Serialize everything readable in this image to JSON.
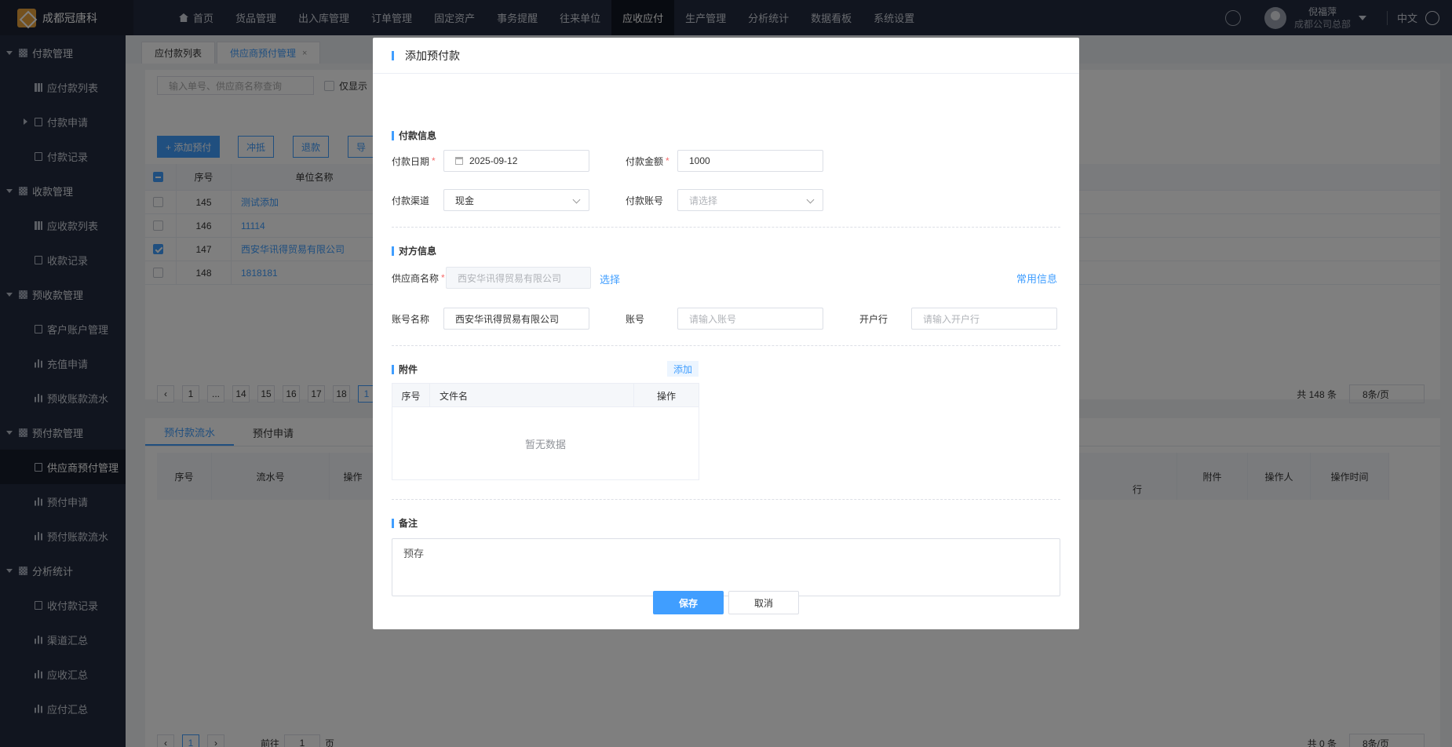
{
  "app": {
    "name": "成都冠唐科"
  },
  "nav": {
    "items": [
      "首页",
      "货品管理",
      "出入库管理",
      "订单管理",
      "固定资产",
      "事务提醒",
      "往来单位",
      "应收应付",
      "生产管理",
      "分析统计",
      "数据看板",
      "系统设置"
    ],
    "active_index": 7
  },
  "user": {
    "name": "倪福萍",
    "org": "成都公司总部",
    "lang": "中文"
  },
  "sidebar": {
    "g1": "付款管理",
    "g1_items": [
      "应付款列表",
      "付款申请",
      "付款记录"
    ],
    "g2": "收款管理",
    "g2_items": [
      "应收款列表",
      "收款记录"
    ],
    "g3": "预收款管理",
    "g3_items": [
      "客户账户管理",
      "充值申请",
      "预收账款流水"
    ],
    "g4": "预付款管理",
    "g4_items": [
      "供应商预付管理",
      "预付申请",
      "预付账款流水"
    ],
    "g5": "分析统计",
    "g5_items": [
      "收付款记录",
      "渠道汇总",
      "应收汇总",
      "应付汇总"
    ]
  },
  "tabs": {
    "t1": "应付款列表",
    "t2": "供应商预付管理",
    "close": "×"
  },
  "list": {
    "search_placeholder": "输入单号、供应商名称查询",
    "only_show": "仅显示",
    "btn_add": "+ 添加预付",
    "btn_offset": "冲抵",
    "btn_refund": "退款",
    "btn_export": "导",
    "col_index": "序号",
    "col_name": "单位名称",
    "rows": [
      {
        "index": "145",
        "name": "测试添加"
      },
      {
        "index": "146",
        "name": "11114"
      },
      {
        "index": "147",
        "name": "西安华讯得贸易有限公司"
      },
      {
        "index": "148",
        "name": "1818181"
      }
    ],
    "pages": [
      "1",
      "...",
      "14",
      "15",
      "16",
      "17",
      "18",
      "1"
    ],
    "total": "共 148 条",
    "page_size": "8条/页"
  },
  "flow": {
    "tab1": "预付款流水",
    "tab2": "预付申请",
    "cols": [
      "序号",
      "流水号",
      "操作",
      "行",
      "附件",
      "操作人",
      "操作时间"
    ],
    "page": "1",
    "goto_label": "前往",
    "goto_value": "1",
    "page_unit": "页",
    "total": "共 0 条",
    "page_size": "8条/页"
  },
  "dialog": {
    "title": "添加预付款",
    "sec_payment": "付款信息",
    "pay_date_label": "付款日期",
    "pay_date": "2025-09-12",
    "pay_amount_label": "付款金额",
    "pay_amount": "1000",
    "channel_label": "付款渠道",
    "channel": "现金",
    "account_label": "付款账号",
    "account_placeholder": "请选择",
    "sec_party": "对方信息",
    "supplier_label": "供应商名称",
    "supplier": "西安华讯得贸易有限公司",
    "select_link": "选择",
    "common_info": "常用信息",
    "acct_name_label": "账号名称",
    "acct_name": "西安华讯得贸易有限公司",
    "acct_no_label": "账号",
    "acct_no_placeholder": "请输入账号",
    "bank_label": "开户行",
    "bank_placeholder": "请输入开户行",
    "sec_attach": "附件",
    "attach_add": "添加",
    "attach_col_index": "序号",
    "attach_col_file": "文件名",
    "attach_col_op": "操作",
    "attach_empty": "暂无数据",
    "sec_remark": "备注",
    "remark": "预存",
    "save": "保存",
    "cancel": "取消",
    "required_mark": "*"
  }
}
